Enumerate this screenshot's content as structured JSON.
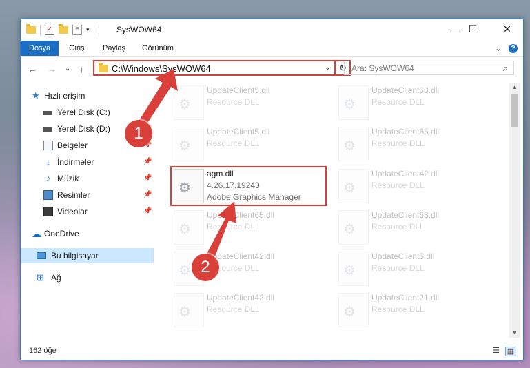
{
  "window": {
    "title": "SysWOW64",
    "minimize": "—",
    "maximize": "☐",
    "close": "✕"
  },
  "ribbon": {
    "tabs": [
      "Dosya",
      "Giriş",
      "Paylaş",
      "Görünüm"
    ],
    "expand": "⌄",
    "help": "?"
  },
  "nav": {
    "back": "←",
    "forward": "→",
    "recent": "⌄",
    "up": "↑",
    "address": "C:\\Windows\\SysWOW64",
    "address_dropdown": "⌄",
    "refresh": "↻",
    "search_placeholder": "Ara: SysWOW64",
    "search_icon": "⌕"
  },
  "sidebar": {
    "items": [
      {
        "label": "Hızlı erişim",
        "icon": "star-icon",
        "pinned": false
      },
      {
        "label": "Yerel Disk (C:)",
        "icon": "drive-icon",
        "pinned": true
      },
      {
        "label": "Yerel Disk (D:)",
        "icon": "drive-icon",
        "pinned": true
      },
      {
        "label": "Belgeler",
        "icon": "documents-icon",
        "pinned": true
      },
      {
        "label": "İndirmeler",
        "icon": "downloads-icon",
        "pinned": true
      },
      {
        "label": "Müzik",
        "icon": "music-icon",
        "pinned": true
      },
      {
        "label": "Resimler",
        "icon": "pictures-icon",
        "pinned": true
      },
      {
        "label": "Videolar",
        "icon": "videos-icon",
        "pinned": true
      },
      {
        "label": "OneDrive",
        "icon": "cloud-icon",
        "pinned": false
      },
      {
        "label": "Bu bilgisayar",
        "icon": "computer-icon",
        "pinned": false
      },
      {
        "label": "Ağ",
        "icon": "network-icon",
        "pinned": false
      }
    ],
    "pin_glyph": "📌"
  },
  "files": [
    {
      "name": "UpdateClient5.dll",
      "line2": "Resource DLL",
      "line3": ""
    },
    {
      "name": "UpdateClient63.dll",
      "line2": "Resource DLL",
      "line3": ""
    },
    {
      "name": "UpdateClient5.dll",
      "line2": "Resource DLL",
      "line3": ""
    },
    {
      "name": "UpdateClient65.dll",
      "line2": "Resource DLL",
      "line3": ""
    },
    {
      "name": "agm.dll",
      "line2": "4.26.17.19243",
      "line3": "Adobe Graphics Manager"
    },
    {
      "name": "UpdateClient42.dll",
      "line2": "Resource DLL",
      "line3": ""
    },
    {
      "name": "UpdateClient65.dll",
      "line2": "Resource DLL",
      "line3": ""
    },
    {
      "name": "UpdateClient63.dll",
      "line2": "Resource DLL",
      "line3": ""
    },
    {
      "name": "UpdateClient42.dll",
      "line2": "Resource DLL",
      "line3": ""
    },
    {
      "name": "UpdateClient5.dll",
      "line2": "Resource DLL",
      "line3": ""
    },
    {
      "name": "UpdateClient42.dll",
      "line2": "Resource DLL",
      "line3": ""
    },
    {
      "name": "UpdateClient21.dll",
      "line2": "Resource DLL",
      "line3": ""
    }
  ],
  "status": {
    "count": "162 öğe",
    "details_view": "☰",
    "tiles_view": "▦"
  },
  "scroll": {
    "up": "▲",
    "down": "▼"
  },
  "annotations": {
    "badge1": "1",
    "badge2": "2",
    "color": "#d9403a"
  }
}
